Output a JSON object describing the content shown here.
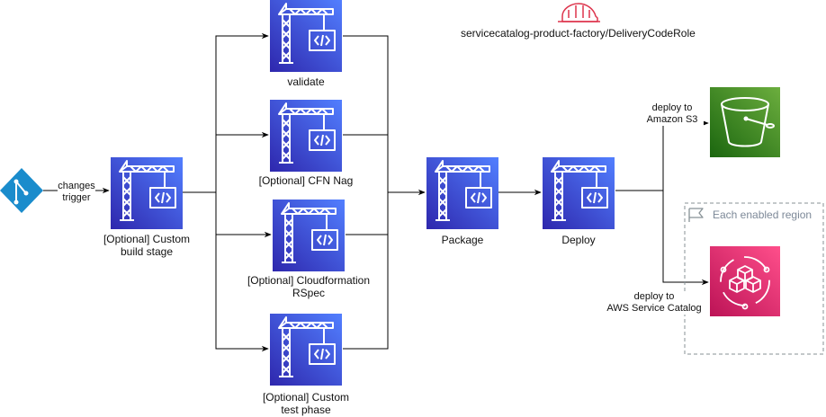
{
  "role": {
    "name": "servicecatalog-product-factory/DeliveryCodeRole",
    "icon": "iam-role-helmet-icon"
  },
  "source": {
    "icon": "git-repository-icon",
    "trigger_label_line1": "changes",
    "trigger_label_line2": "trigger"
  },
  "stages": {
    "custom_build": {
      "line1": "[Optional] Custom",
      "line2": "build stage",
      "icon": "codebuild-icon"
    },
    "validate": {
      "line1": "validate",
      "icon": "codebuild-icon"
    },
    "cfn_nag": {
      "line1": "[Optional] CFN Nag",
      "icon": "codebuild-icon"
    },
    "cfn_rspec": {
      "line1": "[Optional] Cloudformation",
      "line2": "RSpec",
      "icon": "codebuild-icon"
    },
    "custom_test": {
      "line1": "[Optional] Custom",
      "line2": "test phase",
      "icon": "codebuild-icon"
    },
    "package": {
      "line1": "Package",
      "icon": "codebuild-icon"
    },
    "deploy": {
      "line1": "Deploy",
      "icon": "codebuild-icon"
    }
  },
  "targets": {
    "s3": {
      "edge_line1": "deploy to",
      "edge_line2": "Amazon S3",
      "icon": "s3-bucket-icon",
      "color": "#3f8624"
    },
    "service_catalog": {
      "edge_line1": "deploy to",
      "edge_line2": "AWS Service Catalog",
      "icon": "service-catalog-icon",
      "color": "#e7157b"
    }
  },
  "region_group": {
    "label": "Each enabled region",
    "icon": "region-flag-icon"
  },
  "colors": {
    "codebuild": "#3b48cc",
    "codebuild_light": "#5a6bf2",
    "role": "#dd344c",
    "git": "#1a8ccc"
  }
}
